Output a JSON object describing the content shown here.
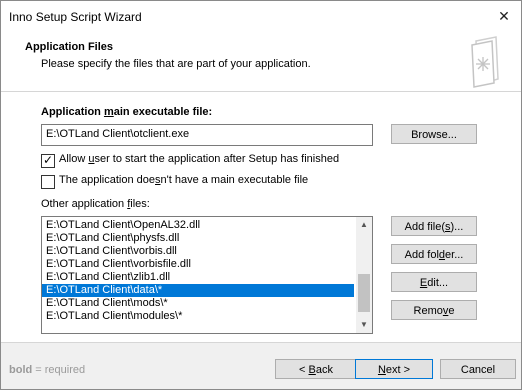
{
  "window": {
    "title": "Inno Setup Script Wizard",
    "close_glyph": "✕"
  },
  "header": {
    "title": "Application Files",
    "subtitle": "Please specify the files that are part of your application."
  },
  "main_exe": {
    "label_pre": "Application ",
    "label_u": "m",
    "label_post": "ain executable file:",
    "value": "E:\\OTLand Client\\otclient.exe",
    "browse_label": "Browse..."
  },
  "options": [
    {
      "pre": "Allow ",
      "u": "u",
      "post": "ser to start the application after Setup has finished",
      "checked": true
    },
    {
      "pre": "The application doe",
      "u": "s",
      "post": "n't have a main executable file",
      "checked": false
    }
  ],
  "other_files": {
    "label_pre": "Other application ",
    "label_u": "f",
    "label_post": "iles:",
    "items": [
      "E:\\OTLand Client\\OpenAL32.dll",
      "E:\\OTLand Client\\physfs.dll",
      "E:\\OTLand Client\\vorbis.dll",
      "E:\\OTLand Client\\vorbisfile.dll",
      "E:\\OTLand Client\\zlib1.dll",
      "E:\\OTLand Client\\data\\*",
      "E:\\OTLand Client\\mods\\*",
      "E:\\OTLand Client\\modules\\*"
    ],
    "selected_index": 5
  },
  "side_buttons": {
    "add_files": {
      "pre": "Add file(",
      "u": "s",
      "post": ")..."
    },
    "add_folder": {
      "pre": "Add fol",
      "u": "d",
      "post": "er..."
    },
    "edit": {
      "pre": "",
      "u": "E",
      "post": "dit..."
    },
    "remove": {
      "pre": "Remo",
      "u": "v",
      "post": "e"
    }
  },
  "footer": {
    "hint_bold": "bold",
    "hint_rest": " = required",
    "back": {
      "pre": "< ",
      "u": "B",
      "post": "ack"
    },
    "next": {
      "pre": "",
      "u": "N",
      "post": "ext >"
    },
    "cancel_label": "Cancel"
  },
  "colors": {
    "selection": "#0078d7",
    "default_button_border": "#0078d7",
    "hint_text": "#9a9a9a"
  }
}
